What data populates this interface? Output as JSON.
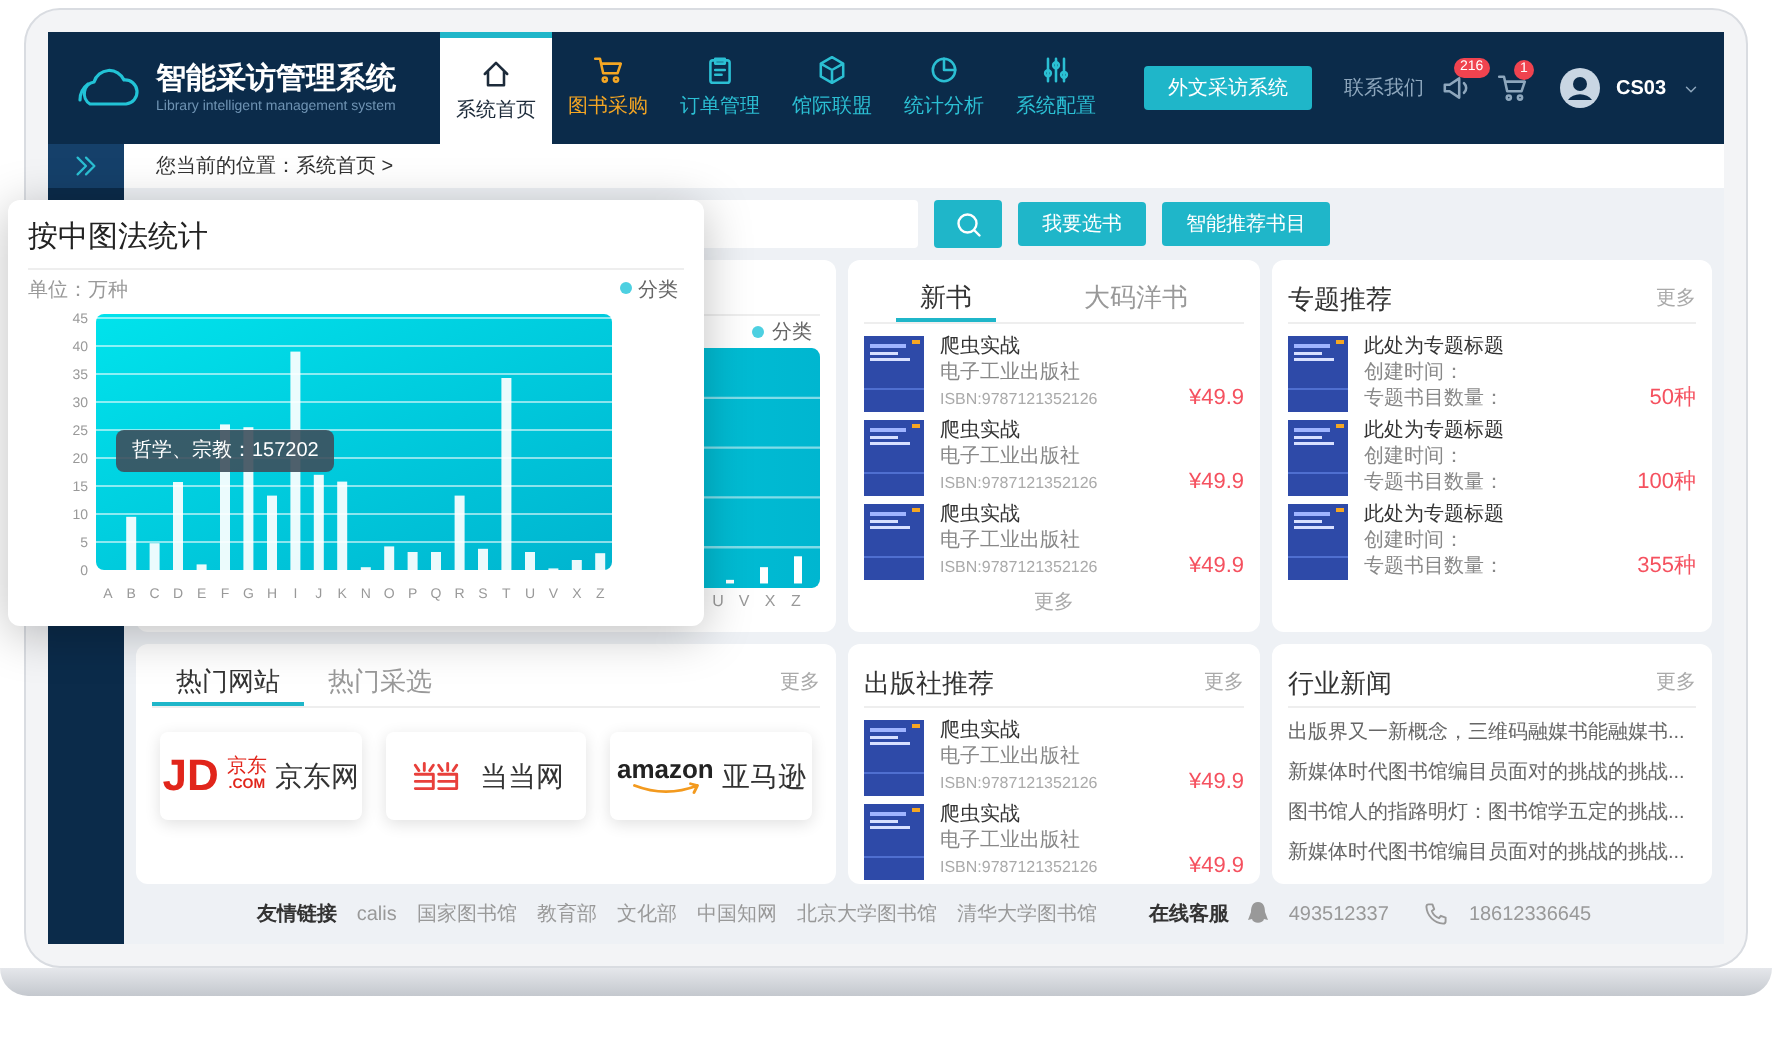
{
  "header": {
    "logo_title": "智能采访管理系统",
    "logo_subtitle": "Library intelligent management system",
    "nav": [
      {
        "label": "系统首页",
        "kind": "home",
        "selected": true,
        "highlighted": false
      },
      {
        "label": "图书采购",
        "kind": "cart",
        "selected": false,
        "highlighted": true
      },
      {
        "label": "订单管理",
        "kind": "clipboard",
        "selected": false,
        "highlighted": false
      },
      {
        "label": "馆际联盟",
        "kind": "cube",
        "selected": false,
        "highlighted": false
      },
      {
        "label": "统计分析",
        "kind": "pie",
        "selected": false,
        "highlighted": false
      },
      {
        "label": "系统配置",
        "kind": "sliders",
        "selected": false,
        "highlighted": false
      }
    ],
    "foreign_button": "外文采访系统",
    "contact": "联系我们",
    "notification_count": "216",
    "cart_count": "1",
    "user": "CS03"
  },
  "breadcrumb": "您当前的位置：系统首页 >",
  "search": {
    "buttons": [
      "我要选书",
      "智能推荐书目"
    ]
  },
  "chart_card": {
    "legend": "分类",
    "x_labels": [
      "U",
      "V",
      "X",
      "Z"
    ]
  },
  "new_books": {
    "tabs": [
      {
        "label": "新书",
        "selected": true
      },
      {
        "label": "大码洋书",
        "selected": false
      }
    ],
    "items": [
      {
        "title": "爬虫实战",
        "publisher": "电子工业出版社",
        "isbn": "ISBN:9787121352126",
        "price": "¥49.9"
      },
      {
        "title": "爬虫实战",
        "publisher": "电子工业出版社",
        "isbn": "ISBN:9787121352126",
        "price": "¥49.9"
      },
      {
        "title": "爬虫实战",
        "publisher": "电子工业出版社",
        "isbn": "ISBN:9787121352126",
        "price": "¥49.9"
      }
    ],
    "more": "更多"
  },
  "topics": {
    "title": "专题推荐",
    "more": "更多",
    "items": [
      {
        "title": "此处为专题标题",
        "created": "创建时间：",
        "count_label": "专题书目数量：",
        "count": "50种"
      },
      {
        "title": "此处为专题标题",
        "created": "创建时间：",
        "count_label": "专题书目数量：",
        "count": "100种"
      },
      {
        "title": "此处为专题标题",
        "created": "创建时间：",
        "count_label": "专题书目数量：",
        "count": "355种"
      }
    ]
  },
  "sites": {
    "tabs": [
      {
        "label": "热门网站",
        "selected": true
      },
      {
        "label": "热门采选",
        "selected": false
      }
    ],
    "more": "更多",
    "items": [
      {
        "kind": "jd",
        "logo": [
          "JD",
          "京东",
          ".COM"
        ],
        "name": "京东网"
      },
      {
        "kind": "dangdang",
        "name": "当当网"
      },
      {
        "kind": "amazon",
        "logo": [
          "amazon"
        ],
        "name": "亚马逊"
      }
    ]
  },
  "publishers": {
    "title": "出版社推荐",
    "more": "更多",
    "items": [
      {
        "title": "爬虫实战",
        "publisher": "电子工业出版社",
        "isbn": "ISBN:9787121352126",
        "price": "¥49.9"
      },
      {
        "title": "爬虫实战",
        "publisher": "电子工业出版社",
        "isbn": "ISBN:9787121352126",
        "price": "¥49.9"
      }
    ]
  },
  "news": {
    "title": "行业新闻",
    "more": "更多",
    "items": [
      "出版界又一新概念，三维码融媒书能融媒书...",
      "新媒体时代图书馆编目员面对的挑战的挑战...",
      "图书馆人的指路明灯：图书馆学五定的挑战...",
      "新媒体时代图书馆编目员面对的挑战的挑战..."
    ]
  },
  "footer": {
    "links_label": "友情链接",
    "links": [
      "calis",
      "国家图书馆",
      "教育部",
      "文化部",
      "中国知网",
      "北京大学图书馆",
      "清华大学图书馆"
    ],
    "service_label": "在线客服",
    "qq": "493512337",
    "phone": "18612336645"
  },
  "popup": {
    "title": "按中图法统计",
    "chart_data": {
      "type": "bar",
      "ylabel": "单位：万种",
      "categories": [
        "A",
        "B",
        "C",
        "D",
        "E",
        "F",
        "G",
        "H",
        "I",
        "J",
        "K",
        "N",
        "O",
        "P",
        "Q",
        "R",
        "S",
        "T",
        "U",
        "V",
        "X",
        "Z"
      ],
      "series": [
        {
          "name": "分类",
          "values": [
            0,
            9.5,
            4.8,
            15.7,
            1,
            26,
            25.5,
            13.3,
            39,
            17,
            15.8,
            0.5,
            4.2,
            3.2,
            3.2,
            13.3,
            3.8,
            34.3,
            3.2,
            0.3,
            1.8,
            3
          ]
        }
      ],
      "ylim": [
        0,
        45
      ],
      "yticks": [
        0,
        5,
        10,
        15,
        20,
        25,
        30,
        35,
        40,
        45
      ],
      "grid": true,
      "annotations": [
        "哲学、宗教：157202"
      ]
    }
  }
}
